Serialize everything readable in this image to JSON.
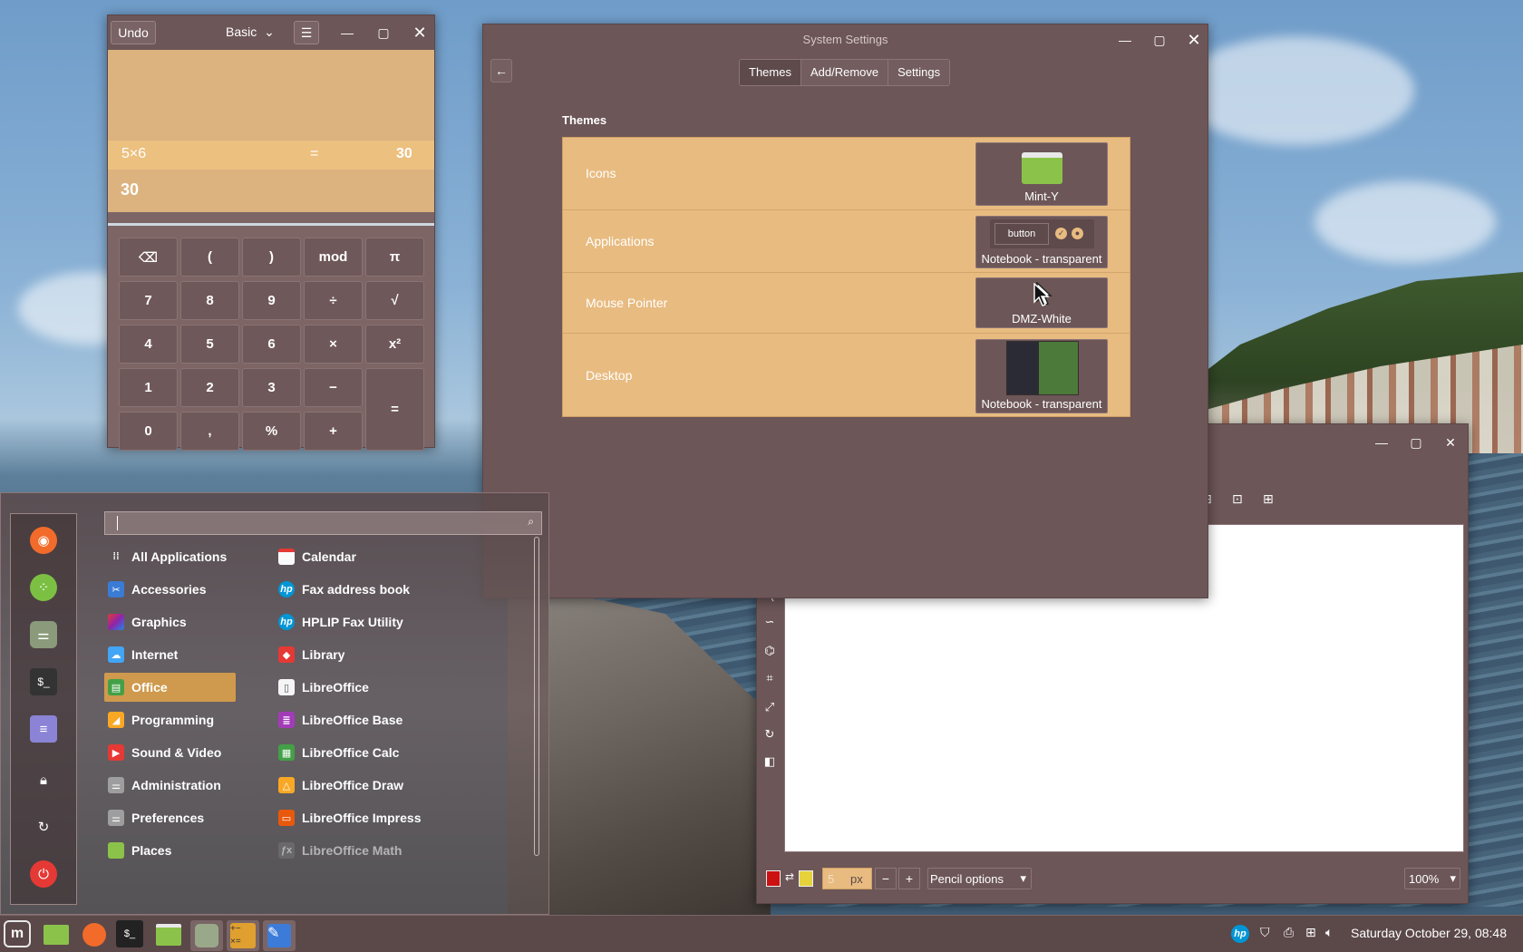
{
  "calculator": {
    "undo": "Undo",
    "mode": "Basic",
    "history_expr": "5×6",
    "history_eq": "=",
    "history_result": "30",
    "result": "30",
    "keys": [
      [
        "⌫",
        "(",
        ")",
        "mod",
        "π"
      ],
      [
        "7",
        "8",
        "9",
        "÷",
        "√"
      ],
      [
        "4",
        "5",
        "6",
        "×",
        "x²"
      ],
      [
        "1",
        "2",
        "3",
        "−",
        "="
      ],
      [
        "0",
        ",",
        "%",
        "+"
      ]
    ]
  },
  "settings": {
    "title": "System Settings",
    "tabs": [
      "Themes",
      "Add/Remove",
      "Settings"
    ],
    "section": "Themes",
    "rows": [
      {
        "label": "Icons",
        "value": "Mint-Y"
      },
      {
        "label": "Applications",
        "value": "Notebook - transparent",
        "preview_button": "button"
      },
      {
        "label": "Mouse Pointer",
        "value": "DMZ-White"
      },
      {
        "label": "Desktop",
        "value": "Notebook - transparent"
      }
    ]
  },
  "drawing": {
    "brush_size": "5",
    "unit": "px",
    "tool_options": "Pencil options",
    "zoom": "100%",
    "primary_color": "#cc1111",
    "secondary_color": "#e6d23a"
  },
  "menu": {
    "search_value": "",
    "categories": [
      "All Applications",
      "Accessories",
      "Graphics",
      "Internet",
      "Office",
      "Programming",
      "Sound & Video",
      "Administration",
      "Preferences",
      "Places"
    ],
    "selected_category": "Office",
    "apps": [
      "Calendar",
      "Fax address book",
      "HPLIP Fax Utility",
      "Library",
      "LibreOffice",
      "LibreOffice Base",
      "LibreOffice Calc",
      "LibreOffice Draw",
      "LibreOffice Impress",
      "LibreOffice Math"
    ]
  },
  "taskbar": {
    "clock": "Saturday October 29, 08:48"
  }
}
